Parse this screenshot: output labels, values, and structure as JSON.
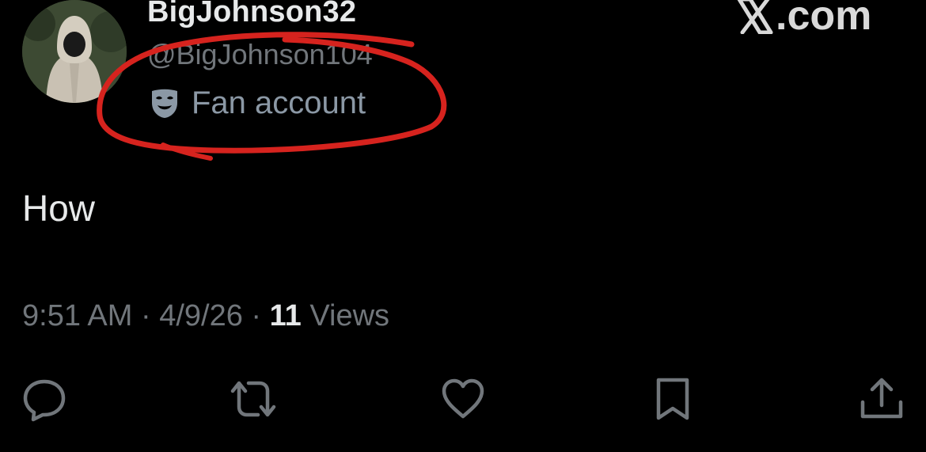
{
  "author": {
    "display_name": "BigJohnson32",
    "handle": "@BigJohnson104",
    "label": "Fan account",
    "avatar_icon": "hooded-figure-avatar",
    "label_icon": "theater-mask-icon"
  },
  "site": {
    "text": ".com",
    "logo_icon": "x-logo-icon"
  },
  "tweet": {
    "text": "How",
    "time": "9:51 AM",
    "separator": "·",
    "date": "4/9/26",
    "views_count": "11",
    "views_label": "Views"
  },
  "actions": [
    {
      "icon": "reply-icon"
    },
    {
      "icon": "repost-icon"
    },
    {
      "icon": "like-icon"
    },
    {
      "icon": "bookmark-icon"
    },
    {
      "icon": "share-icon"
    }
  ],
  "colors": {
    "background": "#000000",
    "primary_text": "#e7e9ea",
    "secondary_text": "#71767b",
    "annotation": "#d6231e"
  }
}
